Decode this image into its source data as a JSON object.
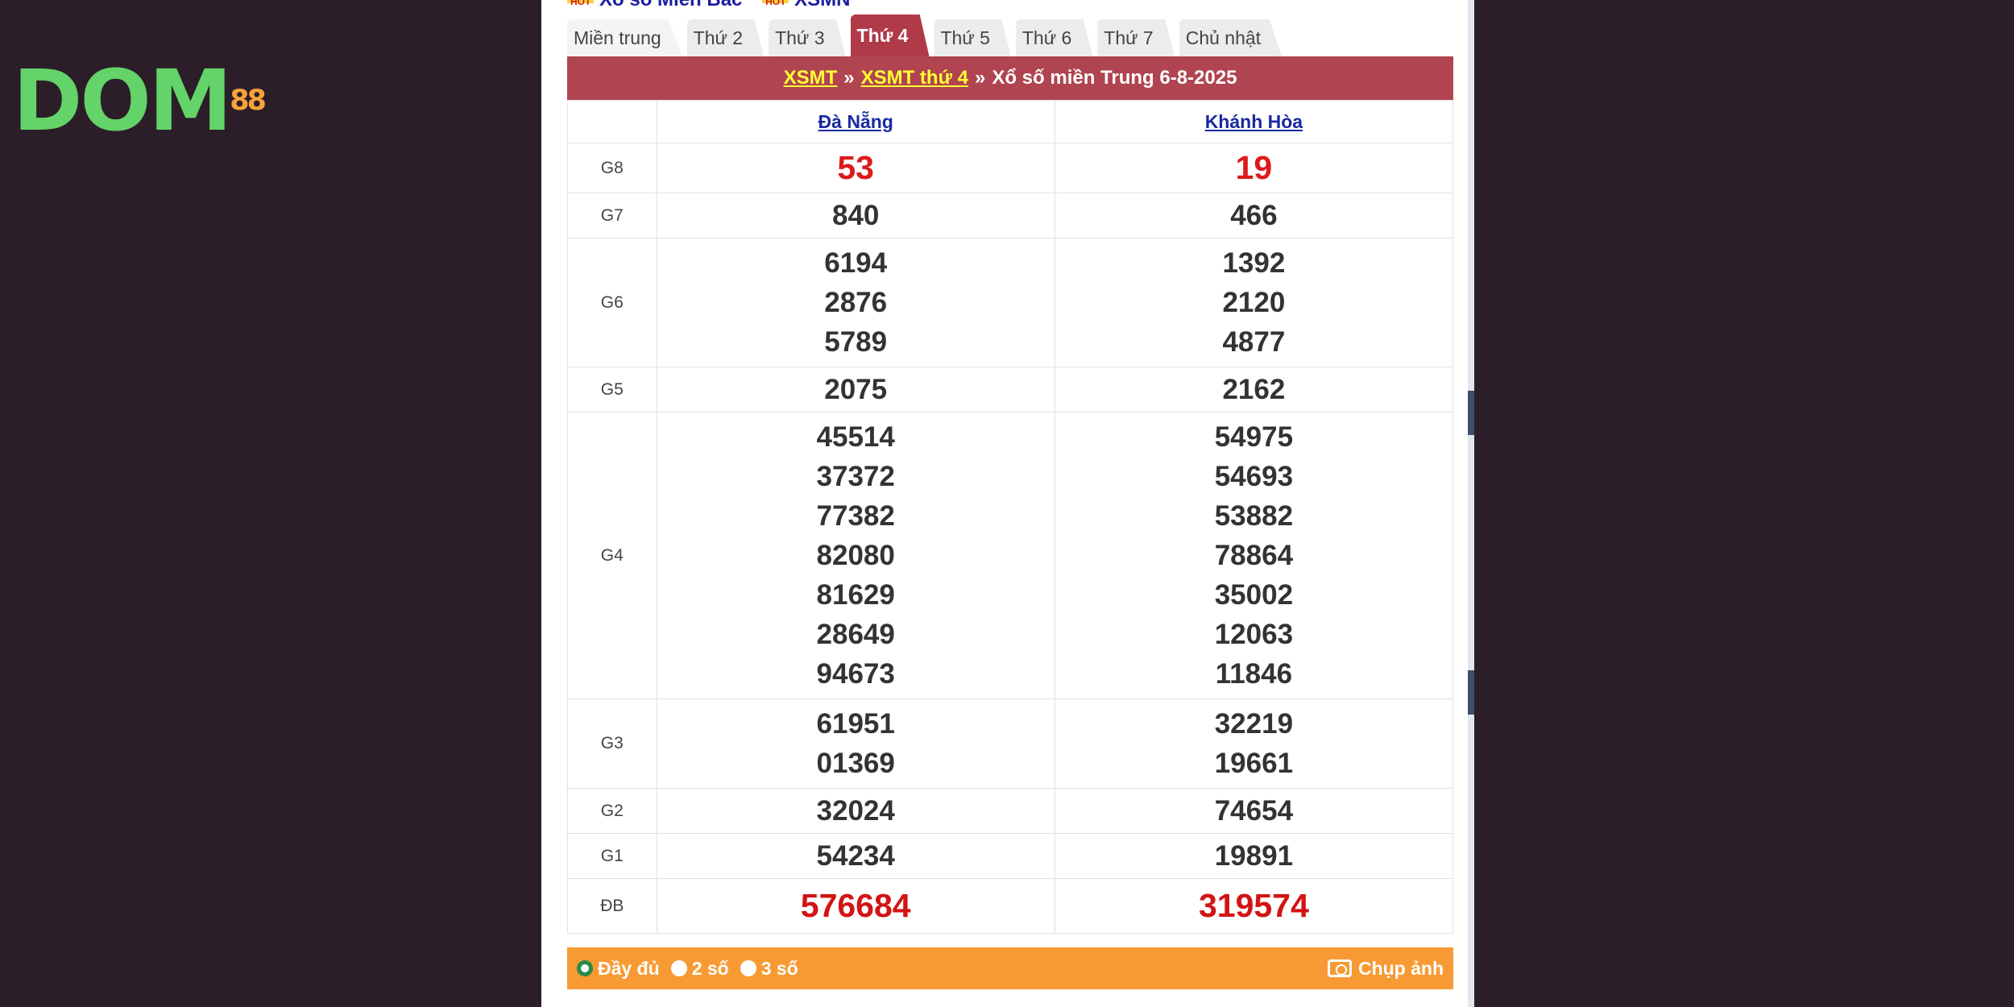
{
  "logo": {
    "part1": "DOM",
    "part2": "88"
  },
  "topbar": {
    "badge": "HOT",
    "links": [
      "Xổ số Miền Bắc",
      "XSMN"
    ]
  },
  "tabs": [
    {
      "label": "Miền trung"
    },
    {
      "label": "Thứ 2"
    },
    {
      "label": "Thứ 3"
    },
    {
      "label": "Thứ 4",
      "active": true
    },
    {
      "label": "Thứ 5"
    },
    {
      "label": "Thứ 6"
    },
    {
      "label": "Thứ 7"
    },
    {
      "label": "Chủ nhật"
    }
  ],
  "title_bar": {
    "link1": "XSMT",
    "sep1": "»",
    "link2": "XSMT thứ 4",
    "sep2": "»",
    "text": "Xổ số miền Trung 6-8-2025"
  },
  "provinces": [
    "Đà Nẵng",
    "Khánh Hòa"
  ],
  "prizes": [
    {
      "label": "G8",
      "danang": [
        "53"
      ],
      "khanhhoa": [
        "19"
      ]
    },
    {
      "label": "G7",
      "danang": [
        "840"
      ],
      "khanhhoa": [
        "466"
      ]
    },
    {
      "label": "G6",
      "danang": [
        "6194",
        "2876",
        "5789"
      ],
      "khanhhoa": [
        "1392",
        "2120",
        "4877"
      ]
    },
    {
      "label": "G5",
      "danang": [
        "2075"
      ],
      "khanhhoa": [
        "2162"
      ]
    },
    {
      "label": "G4",
      "danang": [
        "45514",
        "37372",
        "77382",
        "82080",
        "81629",
        "28649",
        "94673"
      ],
      "khanhhoa": [
        "54975",
        "54693",
        "53882",
        "78864",
        "35002",
        "12063",
        "11846"
      ]
    },
    {
      "label": "G3",
      "danang": [
        "61951",
        "01369"
      ],
      "khanhhoa": [
        "32219",
        "19661"
      ]
    },
    {
      "label": "G2",
      "danang": [
        "32024"
      ],
      "khanhhoa": [
        "74654"
      ]
    },
    {
      "label": "G1",
      "danang": [
        "54234"
      ],
      "khanhhoa": [
        "19891"
      ]
    },
    {
      "label": "ĐB",
      "danang": [
        "576684"
      ],
      "khanhhoa": [
        "319574"
      ]
    }
  ],
  "footer": {
    "options": [
      "Đầy đủ",
      "2 số",
      "3 số"
    ],
    "selected": "Đầy đủ",
    "snapshot": "Chụp ảnh"
  }
}
